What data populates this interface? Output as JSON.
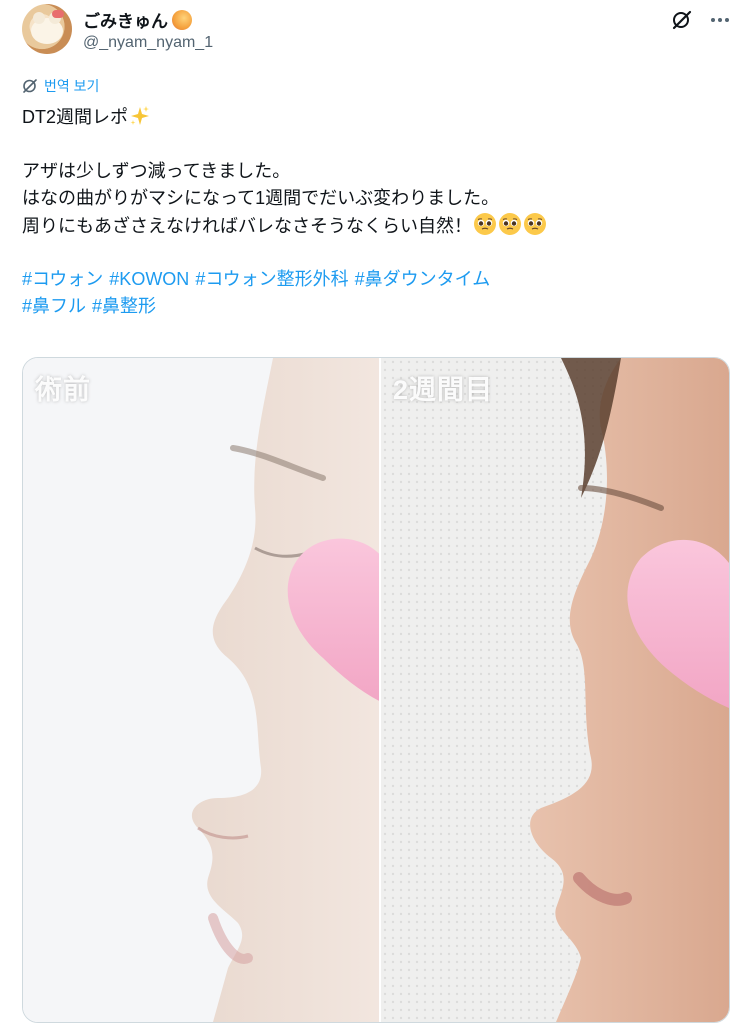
{
  "user": {
    "display_name": "ごみきゅん",
    "handle": "@_nyam_nyam_1"
  },
  "icons": {
    "avatar": "avatar-image",
    "name_emoji": "shrimp-emoji",
    "grok": "grok-icon",
    "more": "more-icon",
    "translate": "translate-icon"
  },
  "translate_label": "번역 보기",
  "tweet": {
    "line1": "DT2週間レポ",
    "line2": "アザは少しずつ減ってきました。",
    "line3": "はなの曲がりがマシになって1週間でだいぶ変わりました。",
    "line4": "周りにもあざさえなければバレなさそうなくらい自然！",
    "hashtags_row1": [
      "#コウォン",
      "#KOWON",
      "#コウォン整形外科",
      "#鼻ダウンタイム"
    ],
    "hashtags_row2": [
      "#鼻フル",
      "#鼻整形"
    ]
  },
  "media": {
    "left_label": "術前",
    "right_label": "2週間目"
  },
  "colors": {
    "link": "#1d9bf0",
    "text": "#0f1419",
    "secondary": "#536471",
    "heart": "#f5b3cf"
  }
}
